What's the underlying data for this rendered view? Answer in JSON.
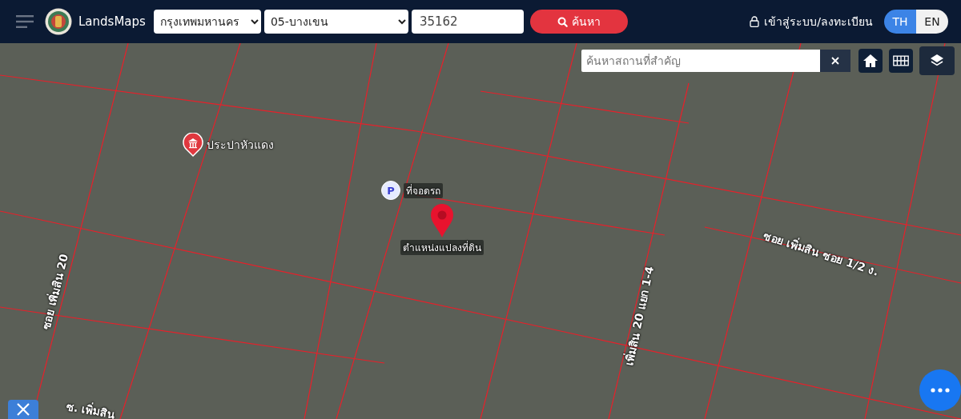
{
  "header": {
    "logo_text": "LandsMaps",
    "province": {
      "value": "กรุงเทพมหานคร"
    },
    "district": {
      "value": "05-บางเขน"
    },
    "parcel_number": {
      "value": "35162"
    },
    "search_button": "ค้นหา",
    "login_link": "เข้าสู่ระบบ/ลงทะเบียน",
    "languages": [
      {
        "label": "TH",
        "selected": true
      },
      {
        "label": "EN",
        "selected": false
      }
    ]
  },
  "map": {
    "place_search": {
      "placeholder": "ค้นหาสถานที่สำคัญ"
    },
    "markers": [
      {
        "kind": "poi",
        "label": "ประปาหัวแดง"
      },
      {
        "kind": "parking",
        "icon_text": "P",
        "label": "ที่จอดรถ"
      },
      {
        "kind": "parcel",
        "label": "ตำแหน่งแปลงที่ดิน"
      }
    ],
    "road_labels": [
      "ซอย เพิ่มสิน 20",
      "เพิ่มสิน 20 แยก 1-4",
      "ซอย เพิ่มสิน ซอย 1/2 ง.",
      "ซ. เพิ่มสิน"
    ]
  }
}
